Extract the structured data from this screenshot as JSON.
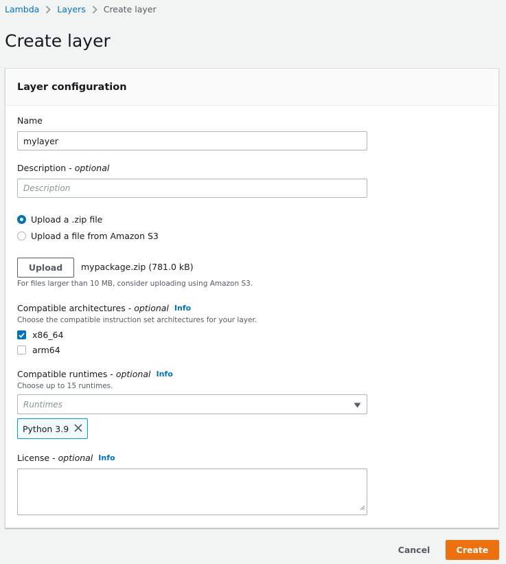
{
  "breadcrumb": {
    "items": [
      "Lambda",
      "Layers"
    ],
    "current": "Create layer"
  },
  "page": {
    "title": "Create layer"
  },
  "panel": {
    "title": "Layer configuration"
  },
  "name_field": {
    "label": "Name",
    "value": "mylayer"
  },
  "description_field": {
    "label": "Description -",
    "optional": "optional",
    "placeholder": "Description"
  },
  "upload_options": [
    {
      "label": "Upload a .zip file",
      "checked": true
    },
    {
      "label": "Upload a file from Amazon S3",
      "checked": false
    }
  ],
  "upload": {
    "button_label": "Upload",
    "file_name": "mypackage.zip (781.0 kB)",
    "hint": "For files larger than 10 MB, consider uploading using Amazon S3."
  },
  "architectures": {
    "label": "Compatible architectures -",
    "optional": "optional",
    "info": "Info",
    "hint": "Choose the compatible instruction set architectures for your layer.",
    "options": [
      {
        "label": "x86_64",
        "checked": true
      },
      {
        "label": "arm64",
        "checked": false
      }
    ]
  },
  "runtimes": {
    "label": "Compatible runtimes -",
    "optional": "optional",
    "info": "Info",
    "hint": "Choose up to 15 runtimes.",
    "placeholder": "Runtimes",
    "selected": [
      "Python 3.9"
    ]
  },
  "license": {
    "label": "License -",
    "optional": "optional",
    "info": "Info",
    "value": ""
  },
  "actions": {
    "cancel": "Cancel",
    "create": "Create"
  },
  "colors": {
    "accent": "#0073bb",
    "primary_button": "#ec7211",
    "token_border": "#00a1c9"
  }
}
